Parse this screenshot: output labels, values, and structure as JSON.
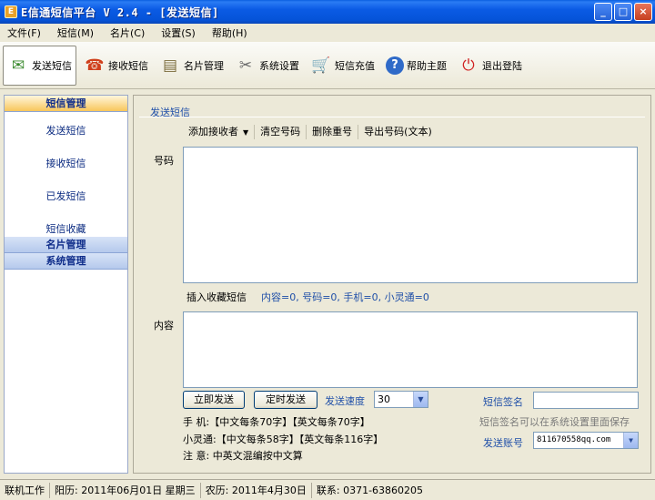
{
  "window": {
    "title": "E信通短信平台 V  2.4 - [发送短信]",
    "app_icon_glyph": "E"
  },
  "menu": [
    "文件(F)",
    "短信(M)",
    "名片(C)",
    "设置(S)",
    "帮助(H)"
  ],
  "toolbar": [
    {
      "label": "发送短信",
      "icon": "send-sms-icon",
      "glyph": "✉",
      "active": true
    },
    {
      "label": "接收短信",
      "icon": "receive-sms-icon",
      "glyph": "☎"
    },
    {
      "label": "名片管理",
      "icon": "card-icon",
      "glyph": "▤"
    },
    {
      "label": "系统设置",
      "icon": "tools-icon",
      "glyph": "✂"
    },
    {
      "label": "短信充值",
      "icon": "cart-icon",
      "glyph": "🛒"
    },
    {
      "label": "帮助主题",
      "icon": "help-icon",
      "glyph": "?"
    },
    {
      "label": "退出登陆",
      "icon": "power-icon",
      "glyph": "⏻"
    }
  ],
  "sidebar": {
    "sms_header": "短信管理",
    "items": [
      "发送短信",
      "接收短信",
      "已发短信",
      "短信收藏"
    ],
    "card_header": "名片管理",
    "system_header": "系统管理"
  },
  "main": {
    "section_title": "发送短信",
    "subtools": {
      "add_recipient": "添加接收者",
      "clear_numbers": "清空号码",
      "remove_dup": "删除重号",
      "export": "导出号码(文本)"
    },
    "number_label": "号码",
    "insert_favorite": "插入收藏短信",
    "counts": "内容=0, 号码=0, 手机=0, 小灵通=0",
    "content_label": "内容",
    "send_now": "立即发送",
    "send_timed": "定时发送",
    "speed_label": "发送速度",
    "speed_value": "30",
    "signature_label": "短信签名",
    "signature_hint": "短信签名可以在系统设置里面保存",
    "account_label": "发送账号",
    "account_value": "811670558qq.com",
    "info_mobile": "手  机:【中文每条70字】【英文每条70字】",
    "info_phs": "小灵通:【中文每条58字】【英文每条116字】",
    "info_note": "注  意: 中英文混编按中文算"
  },
  "status": {
    "mode": "联机工作",
    "solar": "阳历: 2011年06月01日 星期三",
    "lunar": "农历: 2011年4月30日",
    "contact": "联系: 0371-63860205"
  }
}
